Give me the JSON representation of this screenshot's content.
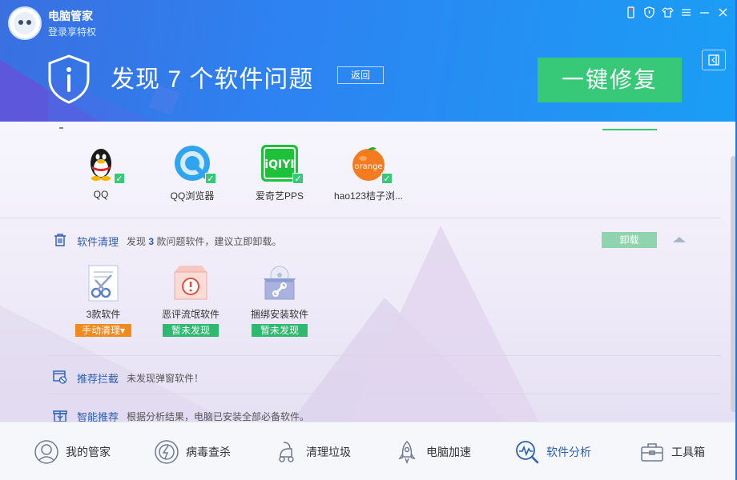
{
  "app": {
    "name": "电脑管家",
    "login": "登录享特权"
  },
  "header": {
    "title": "发现 7 个软件问题",
    "back_label": "返回",
    "fix_label": "一键修复"
  },
  "software": [
    {
      "label": "QQ",
      "icon": "qq-icon"
    },
    {
      "label": "QQ浏览器",
      "icon": "qq-browser-icon"
    },
    {
      "label": "爱奇艺PPS",
      "icon": "iqiyi-icon"
    },
    {
      "label": "hao123桔子浏...",
      "icon": "orange-browser-icon",
      "icon_text": "orange"
    }
  ],
  "clean": {
    "title": "软件清理",
    "desc_prefix": "发现",
    "count": "3",
    "desc_suffix": "款问题软件，建议立即卸载。",
    "uninstall_label": "卸载",
    "categories": [
      {
        "label": "3款软件",
        "tag": "手动清理▾",
        "icon": "scissors-icon"
      },
      {
        "label": "恶评流氓软件",
        "tag": "暂未发现",
        "icon": "alert-box-icon"
      },
      {
        "label": "捆绑安装软件",
        "tag": "暂未发现",
        "icon": "bundle-disc-icon"
      }
    ]
  },
  "intercept": {
    "title": "推荐拦截",
    "desc": "未发现弹窗软件！"
  },
  "recommend": {
    "title": "智能推荐",
    "desc": "根据分析结果，电脑已安装全部必备软件。"
  },
  "nav": [
    {
      "label": "我的管家",
      "icon": "butler-icon"
    },
    {
      "label": "病毒查杀",
      "icon": "virus-scan-icon"
    },
    {
      "label": "清理垃圾",
      "icon": "vacuum-icon"
    },
    {
      "label": "电脑加速",
      "icon": "rocket-icon"
    },
    {
      "label": "软件分析",
      "icon": "software-analysis-icon"
    },
    {
      "label": "工具箱",
      "icon": "toolbox-icon"
    }
  ],
  "colors": {
    "accent_green": "#38c978",
    "brand_blue": "#2d83f2",
    "link_blue": "#2b5fb3",
    "orange": "#f08a1c"
  }
}
